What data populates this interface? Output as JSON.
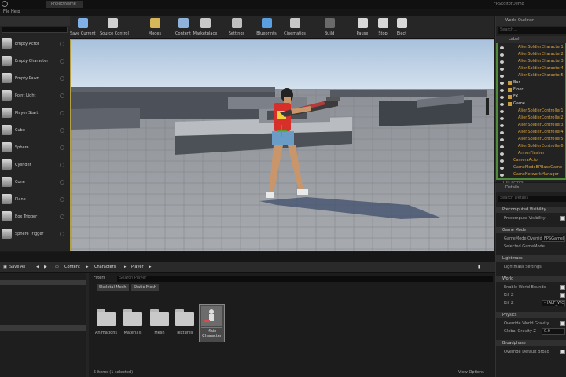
{
  "titlebar": {
    "tab": "ProjectName",
    "project": "FPSEditorDemo"
  },
  "menubar": {
    "items": [
      "File",
      "Help"
    ]
  },
  "modes": {
    "search_placeholder": "",
    "items": [
      {
        "label": "Empty Actor",
        "icon": "cube-icon"
      },
      {
        "label": "Empty Character",
        "icon": "character-icon"
      },
      {
        "label": "Empty Pawn",
        "icon": "pawn-icon"
      },
      {
        "label": "Point Light",
        "icon": "light-bulb-icon"
      },
      {
        "label": "Player Start",
        "icon": "player-start-icon"
      },
      {
        "label": "Cube",
        "icon": "cube-icon"
      },
      {
        "label": "Sphere",
        "icon": "sphere-icon"
      },
      {
        "label": "Cylinder",
        "icon": "cylinder-icon"
      },
      {
        "label": "Cone",
        "icon": "cone-icon"
      },
      {
        "label": "Plane",
        "icon": "plane-icon"
      },
      {
        "label": "Box Trigger",
        "icon": "box-trigger-icon"
      },
      {
        "label": "Sphere Trigger",
        "icon": "sphere-trigger-icon"
      }
    ]
  },
  "toolbar": {
    "items": [
      {
        "label": "Save Current",
        "icon": "save-icon",
        "color": "#7fb0e8"
      },
      {
        "label": "Source Control",
        "icon": "source-control-icon",
        "color": "#d0d0d0"
      },
      {
        "label": "Modes",
        "icon": "modes-icon",
        "color": "#d6b658"
      },
      {
        "label": "Content",
        "icon": "content-icon",
        "color": "#8fb3da"
      },
      {
        "label": "Marketplace",
        "icon": "marketplace-icon",
        "color": "#c8c8c8"
      },
      {
        "label": "Settings",
        "icon": "settings-icon",
        "color": "#bfbfbf"
      },
      {
        "label": "Blueprints",
        "icon": "blueprints-icon",
        "color": "#5aa0e0"
      },
      {
        "label": "Cinematics",
        "icon": "cinematics-icon",
        "color": "#c8c8c8"
      },
      {
        "label": "Build",
        "icon": "build-icon",
        "color": "#6a6a6a"
      },
      {
        "label": "Pause",
        "icon": "pause-icon",
        "color": "#d8d8d8"
      },
      {
        "label": "Stop",
        "icon": "stop-icon",
        "color": "#d8d8d8"
      },
      {
        "label": "Eject",
        "icon": "eject-icon",
        "color": "#d8d8d8"
      }
    ]
  },
  "outliner": {
    "title": "World Outliner",
    "search_placeholder": "Search...",
    "column_label": "Label",
    "rows": [
      {
        "text": "AlienSoldierCharacter1",
        "indent": 28,
        "folder": false
      },
      {
        "text": "AlienSoldierCharacter2",
        "indent": 28,
        "folder": false
      },
      {
        "text": "AlienSoldierCharacter3",
        "indent": 28,
        "folder": false
      },
      {
        "text": "AlienSoldierCharacter4",
        "indent": 28,
        "folder": false
      },
      {
        "text": "AlienSoldierCharacter5",
        "indent": 28,
        "folder": false
      },
      {
        "text": "Bar",
        "indent": 22,
        "folder": true
      },
      {
        "text": "Floor",
        "indent": 22,
        "folder": true
      },
      {
        "text": "FX",
        "indent": 22,
        "folder": true
      },
      {
        "text": "Game",
        "indent": 22,
        "folder": true
      },
      {
        "text": "AlienSoldierController1",
        "indent": 28,
        "folder": false
      },
      {
        "text": "AlienSoldierController2",
        "indent": 28,
        "folder": false
      },
      {
        "text": "AlienSoldierController3",
        "indent": 28,
        "folder": false
      },
      {
        "text": "AlienSoldierController4",
        "indent": 28,
        "folder": false
      },
      {
        "text": "AlienSoldierController5",
        "indent": 28,
        "folder": false
      },
      {
        "text": "AlienSoldierController6",
        "indent": 28,
        "folder": false
      },
      {
        "text": "ArmorFlasher",
        "indent": 28,
        "folder": false
      },
      {
        "text": "CameraActor",
        "indent": 22,
        "folder": false
      },
      {
        "text": "GameModeBPBaseGame",
        "indent": 22,
        "folder": false
      },
      {
        "text": "GameNetworkManager",
        "indent": 22,
        "folder": false
      }
    ],
    "count": "100 actors"
  },
  "details": {
    "title": "Details",
    "search_placeholder": "Search Details",
    "sections": [
      {
        "category": "Precomputed Visibility",
        "props": [
          {
            "label": "Precompute Visibility",
            "type": "check"
          }
        ]
      },
      {
        "category": "Game Mode",
        "props": [
          {
            "label": "GameMode Override",
            "type": "value",
            "value": "FPSGameMode"
          },
          {
            "label": "Selected GameMode",
            "type": "none"
          }
        ]
      },
      {
        "category": "Lightmass",
        "props": [
          {
            "label": "Lightmass Settings",
            "type": "none"
          }
        ]
      },
      {
        "category": "World",
        "props": [
          {
            "label": "Enable World Bounds",
            "type": "check"
          },
          {
            "label": "Kill Z",
            "type": "check"
          },
          {
            "label": "Kill Z",
            "type": "value",
            "value": "-HALF_WORLD"
          }
        ]
      },
      {
        "category": "Physics",
        "props": [
          {
            "label": "Override World Gravity",
            "type": "check"
          },
          {
            "label": "Global Gravity Z",
            "type": "value",
            "value": "0.0"
          }
        ]
      },
      {
        "category": "Broadphase",
        "props": [
          {
            "label": "Override Default Broad",
            "type": "check"
          }
        ]
      }
    ]
  },
  "content_browser": {
    "save_all": "Save All",
    "crumbs": [
      "Content",
      "Characters",
      "Player"
    ],
    "filters_label": "Filters",
    "search_placeholder": "Search Player",
    "chips": [
      "Skeletal Mesh",
      "Static Mesh"
    ],
    "folders": [
      {
        "label": "Animations"
      },
      {
        "label": "Materials"
      },
      {
        "label": "Mesh"
      },
      {
        "label": "Textures"
      }
    ],
    "asset": {
      "label": "Main Character",
      "icon": "blueprint-character-icon"
    },
    "items_count": "5 items (1 selected)",
    "view_options": "View Options",
    "tree": [
      "",
      "",
      "",
      "",
      ""
    ]
  }
}
